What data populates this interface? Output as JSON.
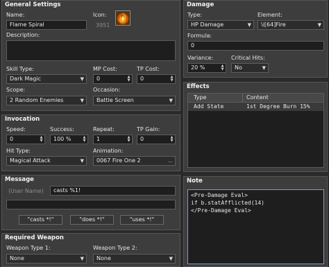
{
  "general": {
    "title": "General Settings",
    "name_label": "Name:",
    "name_value": "Flame Spiral",
    "icon_label": "Icon:",
    "icon_index": "3951",
    "description_label": "Description:",
    "description_value": "",
    "skill_type_label": "Skill Type:",
    "skill_type_value": "Dark Magic",
    "mp_cost_label": "MP Cost:",
    "mp_cost_value": "0",
    "tp_cost_label": "TP Cost:",
    "tp_cost_value": "0",
    "scope_label": "Scope:",
    "scope_value": "2 Random Enemies",
    "occasion_label": "Occasion:",
    "occasion_value": "Battle Screen"
  },
  "invocation": {
    "title": "Invocation",
    "speed_label": "Speed:",
    "speed_value": "0",
    "success_label": "Success:",
    "success_value": "100 %",
    "repeat_label": "Repeat:",
    "repeat_value": "1",
    "tp_gain_label": "TP Gain:",
    "tp_gain_value": "0",
    "hit_type_label": "Hit Type:",
    "hit_type_value": "Magical Attack",
    "animation_label": "Animation:",
    "animation_value": "0067 Fire One 2"
  },
  "message": {
    "title": "Message",
    "user_name_placeholder": "(User Name)",
    "line1_value": "casts %1!",
    "line2_value": "",
    "buttons": [
      "\"casts *!\"",
      "\"does *!\"",
      "\"uses *!\""
    ]
  },
  "required_weapon": {
    "title": "Required Weapon",
    "weapon_type1_label": "Weapon Type 1:",
    "weapon_type1_value": "None",
    "weapon_type2_label": "Weapon Type 2:",
    "weapon_type2_value": "None"
  },
  "damage": {
    "title": "Damage",
    "type_label": "Type:",
    "type_value": "HP Damage",
    "element_label": "Element:",
    "element_value": "\\i[64]Fire",
    "formula_label": "Formula:",
    "formula_value": "0",
    "variance_label": "Variance:",
    "variance_value": "20 %",
    "critical_label": "Critical Hits:",
    "critical_value": "No"
  },
  "effects": {
    "title": "Effects",
    "col_type": "Type",
    "col_content": "Content",
    "rows": [
      {
        "type": "Add State",
        "content": "1st Degree Burn 15%"
      }
    ]
  },
  "note": {
    "title": "Note",
    "lines": [
      "<Pre-Damage Eval>",
      "if b.statAfflicted(14)",
      "</Pre-Damage Eval>"
    ]
  },
  "colors": {
    "panel": "#3d3d3d",
    "field": "#1e1e1e",
    "border": "#565656",
    "selection": "#3e4f73",
    "icon_orange": "#f2a01e"
  },
  "icons": {
    "skill_icon": "flame-spiral-icon"
  }
}
